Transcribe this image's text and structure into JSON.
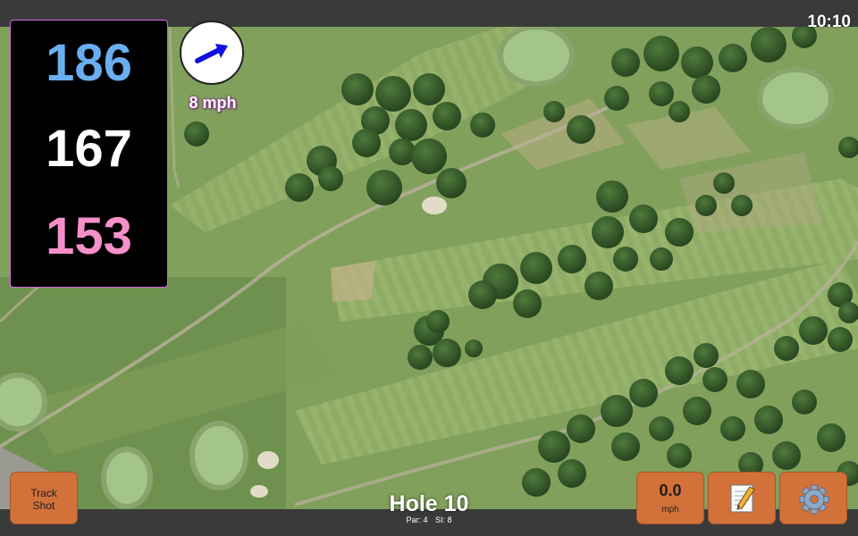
{
  "status": {
    "time": "10:10"
  },
  "distances": {
    "back": "186",
    "middle": "167",
    "front": "153",
    "colors": {
      "back": "#6aaef0",
      "middle": "#ffffff",
      "front": "#f590c8"
    }
  },
  "wind": {
    "speed": "8 mph",
    "direction_icon": "arrow-east-northeast"
  },
  "buttons": {
    "track_shot_line1": "Track",
    "track_shot_line2": "Shot",
    "speed_value": "0.0",
    "speed_unit": "mph",
    "notes_icon": "notepad-pencil-icon",
    "settings_icon": "gear-icon"
  },
  "hole": {
    "title": "Hole 10",
    "par": "Par: 4",
    "si": "SI: 8"
  },
  "colors": {
    "button": "#d2713a",
    "panel_border": "#d46ad8"
  }
}
